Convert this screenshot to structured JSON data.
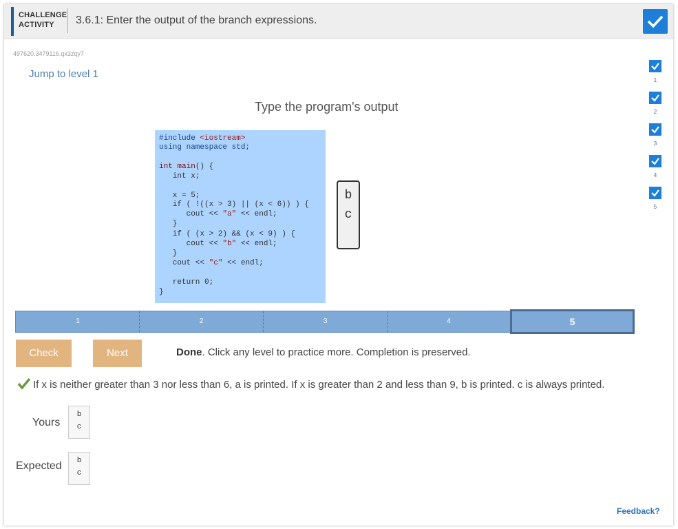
{
  "header": {
    "tag_line1": "CHALLENGE",
    "tag_line2": "ACTIVITY",
    "title": "3.6.1: Enter the output of the branch expressions."
  },
  "activity_id": "497620.3479116.qx3zqy7",
  "jump_link": "Jump to level 1",
  "instruction": "Type the program's output",
  "code_lines": [
    "#include <iostream>",
    "using namespace std;",
    "",
    "int main() {",
    "   int x;",
    "",
    "   x = 5;",
    "   if ( !((x > 3) || (x < 6)) ) {",
    "      cout << \"a\" << endl;",
    "   }",
    "   if ( (x > 2) && (x < 9) ) {",
    "      cout << \"b\" << endl;",
    "   }",
    "   cout << \"c\" << endl;",
    "",
    "   return 0;",
    "}"
  ],
  "output_box": [
    "b",
    "c"
  ],
  "levels": {
    "items": [
      "1",
      "2",
      "3",
      "4",
      "5"
    ],
    "selected": "5"
  },
  "buttons": {
    "check": "Check",
    "next": "Next"
  },
  "status": {
    "bold": "Done",
    "rest": ". Click any level to practice more. Completion is preserved."
  },
  "explanation": "If x is neither greater than 3 nor less than 6, a is printed. If x is greater than 2 and less than 9, b is printed. c is always printed.",
  "yours": {
    "label": "Yours",
    "lines": [
      "b",
      "c"
    ]
  },
  "expected": {
    "label": "Expected",
    "lines": [
      "b",
      "c"
    ]
  },
  "level_indicators": [
    "1",
    "2",
    "3",
    "4",
    "5"
  ],
  "feedback": "Feedback?",
  "colors": {
    "accent_blue": "#1e7fd8",
    "level_bar": "#7fa9d6",
    "button": "#e2b47f",
    "code_bg": "#acd4ff",
    "check_green": "#6b9a3a"
  },
  "icons": {
    "done": "checkmark-icon",
    "level_complete": "checkbox-checked-icon",
    "correct": "green-check-icon"
  }
}
